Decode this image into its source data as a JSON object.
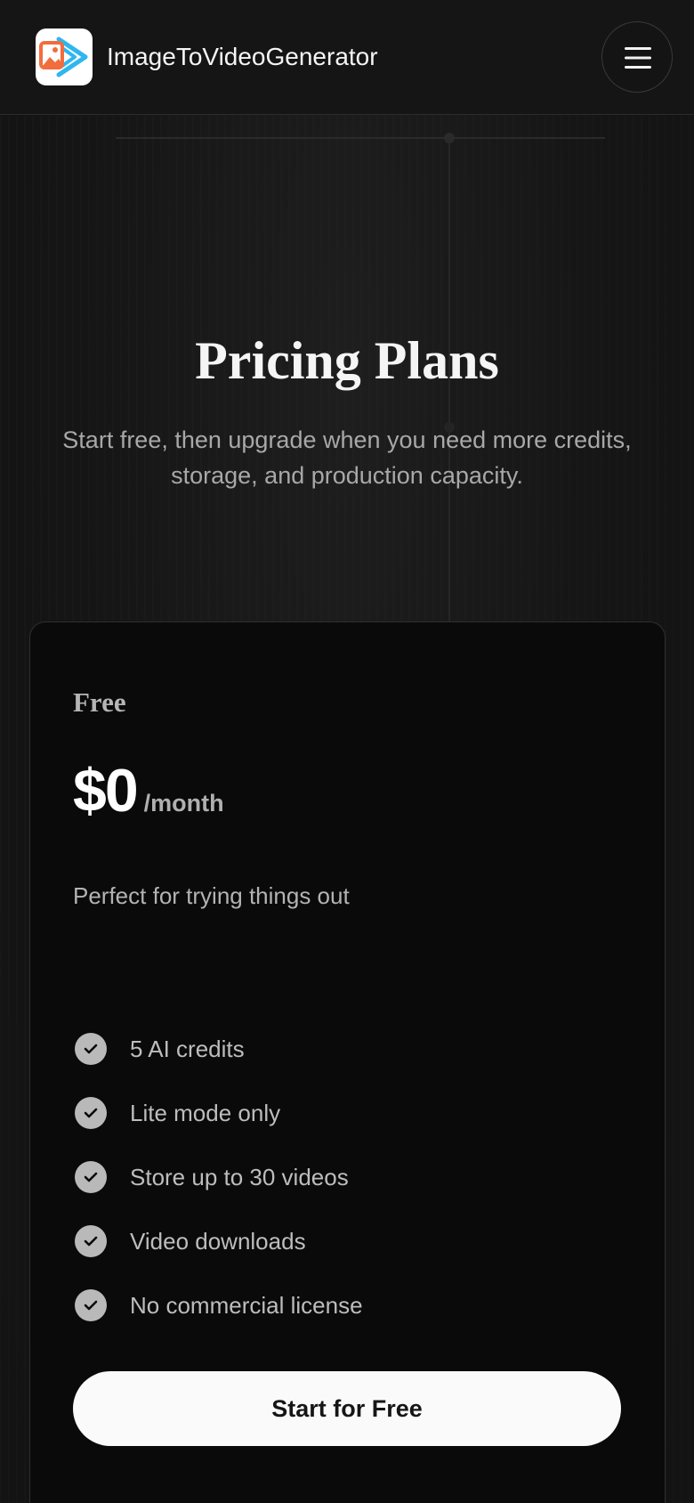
{
  "header": {
    "brand": "ImageToVideoGenerator",
    "logo_icon": "image-to-video-logo-icon",
    "menu_icon": "hamburger-menu-icon"
  },
  "hero": {
    "title": "Pricing Plans",
    "subtitle": "Start free, then upgrade when you need more credits, storage, and production capacity."
  },
  "plan": {
    "name": "Free",
    "price": "$0",
    "period": "/month",
    "description": "Perfect for trying things out",
    "features": [
      "5 AI credits",
      "Lite mode only",
      "Store up to 30 videos",
      "Video downloads",
      "No commercial license"
    ],
    "cta_label": "Start for Free"
  },
  "colors": {
    "background": "#141414",
    "card": "#0a0a0a",
    "logo_orange": "#f26d3d",
    "logo_blue": "#2fb6ef",
    "cta_bg": "#fafafa"
  }
}
